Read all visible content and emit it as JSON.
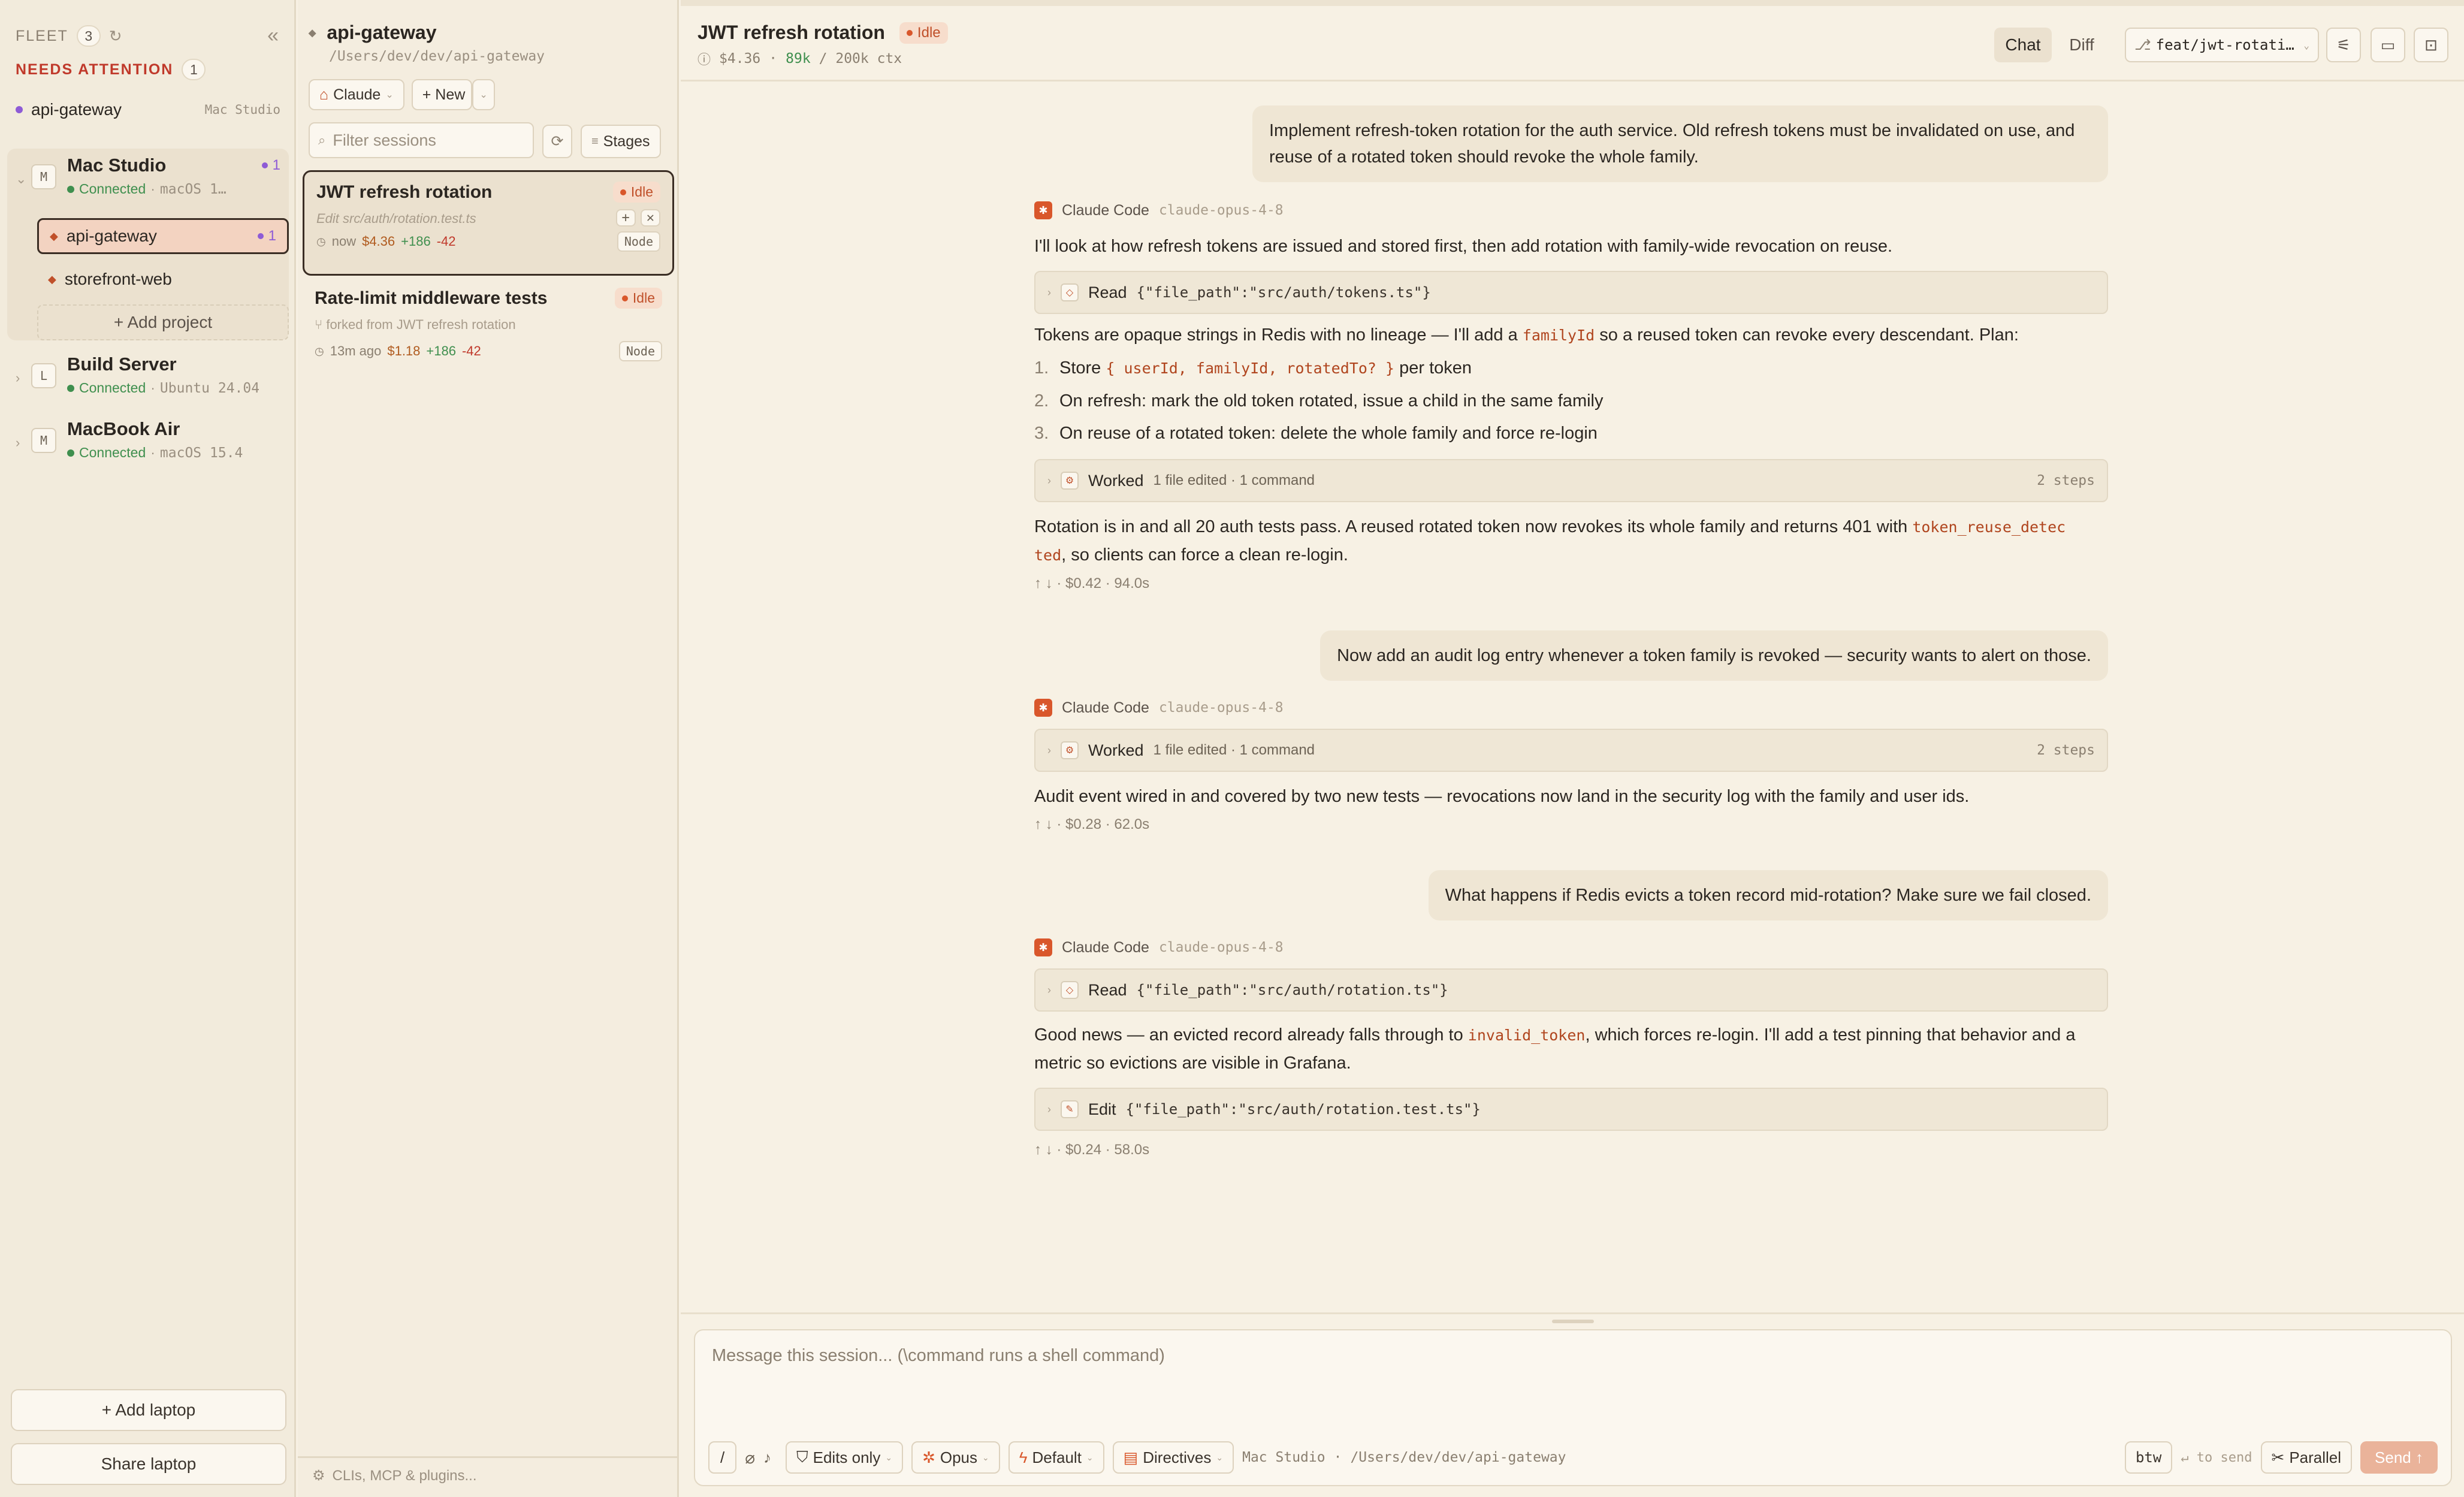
{
  "sidebar": {
    "fleet_label": "FLEET",
    "fleet_count": "3",
    "needs_attention_label": "NEEDS ATTENTION",
    "needs_attention_count": "1",
    "attention_item": {
      "name": "api-gateway",
      "machine": "Mac Studio"
    },
    "machines": [
      {
        "badge": "M",
        "name": "Mac Studio",
        "status": "Connected",
        "os": "macOS 1…",
        "count": "1",
        "projects": [
          {
            "name": "api-gateway",
            "count": "1"
          },
          {
            "name": "storefront-web"
          }
        ],
        "add_project": "+ Add project"
      },
      {
        "badge": "L",
        "name": "Build Server",
        "status": "Connected",
        "os": "Ubuntu 24.04"
      },
      {
        "badge": "M",
        "name": "MacBook Air",
        "status": "Connected",
        "os": "macOS 15.4"
      }
    ],
    "add_laptop": "+ Add laptop",
    "share_laptop": "Share laptop"
  },
  "sessions": {
    "project_title": "api-gateway",
    "project_path": "/Users/dev/dev/api-gateway",
    "agent_button": "Claude",
    "new_button": "+ New",
    "filter_placeholder": "Filter sessions",
    "stages_button": "Stages",
    "items": [
      {
        "title": "JWT refresh rotation",
        "status": "Idle",
        "subtitle": "Edit src/auth/rotation.test.ts",
        "time": "now",
        "cost": "$4.36",
        "added": "+186",
        "removed": "-42",
        "runtime": "Node"
      },
      {
        "title": "Rate-limit middleware tests",
        "status": "Idle",
        "subtitle": "forked from JWT refresh rotation",
        "time": "13m ago",
        "cost": "$1.18",
        "added": "+186",
        "removed": "-42",
        "runtime": "Node"
      }
    ],
    "footer": "CLIs, MCP & plugins..."
  },
  "header": {
    "title": "JWT refresh rotation",
    "status": "Idle",
    "cost": "$4.36",
    "tokens": "89k",
    "ctx": "/ 200k ctx",
    "tab_chat": "Chat",
    "tab_diff": "Diff",
    "branch": "feat/jwt-rotati…"
  },
  "messages": {
    "user1": "Implement refresh-token rotation for the auth service. Old refresh tokens must be invalidated on use, and reuse of a rotated token should revoke the whole family.",
    "agent_name": "Claude Code",
    "agent_model": "claude-opus-4-8",
    "a1_text1": "I'll look at how refresh tokens are issued and stored first, then add rotation with family-wide revocation on reuse.",
    "a1_tool1_name": "Read",
    "a1_tool1_arg": "{\"file_path\":\"src/auth/tokens.ts\"}",
    "a1_text2_pre": "Tokens are opaque strings in Redis with no lineage — I'll add a",
    "a1_text2_code": "familyId",
    "a1_text2_post": "so a reused token can revoke every descendant. Plan:",
    "plan": [
      {
        "num": "1.",
        "pre": "Store",
        "code": "{ userId, familyId, rotatedTo? }",
        "post": "per token"
      },
      {
        "num": "2.",
        "pre": "On refresh: mark the old token rotated, issue a child in the same family",
        "code": "",
        "post": ""
      },
      {
        "num": "3.",
        "pre": "On reuse of a rotated token: delete the whole family and force re-login",
        "code": "",
        "post": ""
      }
    ],
    "a1_tool2_name": "Worked",
    "a1_tool2_sub": "1 file edited · 1 command",
    "a1_tool2_steps": "2 steps",
    "a1_text3_pre": "Rotation is in and all 20 auth tests pass. A reused rotated token now revokes its whole family and returns 401 with",
    "a1_text3_code1": "token_reuse_detec",
    "a1_text3_code2": "ted",
    "a1_text3_post": ", so clients can force a clean re-login.",
    "a1_foot": "$0.42 · 94.0s",
    "user2": "Now add an audit log entry whenever a token family is revoked — security wants to alert on those.",
    "a2_tool_name": "Worked",
    "a2_tool_sub": "1 file edited · 1 command",
    "a2_tool_steps": "2 steps",
    "a2_text": "Audit event wired in and covered by two new tests — revocations now land in the security log with the family and user ids.",
    "a2_foot": "$0.28 · 62.0s",
    "user3": "What happens if Redis evicts a token record mid-rotation? Make sure we fail closed.",
    "a3_tool1_name": "Read",
    "a3_tool1_arg": "{\"file_path\":\"src/auth/rotation.ts\"}",
    "a3_text_pre": "Good news — an evicted record already falls through to",
    "a3_text_code": "invalid_token",
    "a3_text_post": ", which forces re-login. I'll add a test pinning that behavior and a metric so evictions are visible in Grafana.",
    "a3_tool2_name": "Edit",
    "a3_tool2_arg": "{\"file_path\":\"src/auth/rotation.test.ts\"}",
    "a3_foot": "$0.24 · 58.0s"
  },
  "composer": {
    "placeholder": "Message this session...  (\\command runs a shell command)",
    "slash": "/",
    "edits": "Edits only",
    "model": "Opus",
    "mode": "Default",
    "directives": "Directives",
    "machine": "Mac Studio",
    "path": "/Users/dev/dev/api-gateway",
    "btw": "btw",
    "to_send": "↵ to send",
    "parallel": "Parallel",
    "send": "Send ↑"
  },
  "colors": {
    "accent": "#d9572b",
    "idle": "#c0502a",
    "ok": "#3f8f4e",
    "attention": "#c0392b",
    "purple": "#8e5bd6"
  }
}
